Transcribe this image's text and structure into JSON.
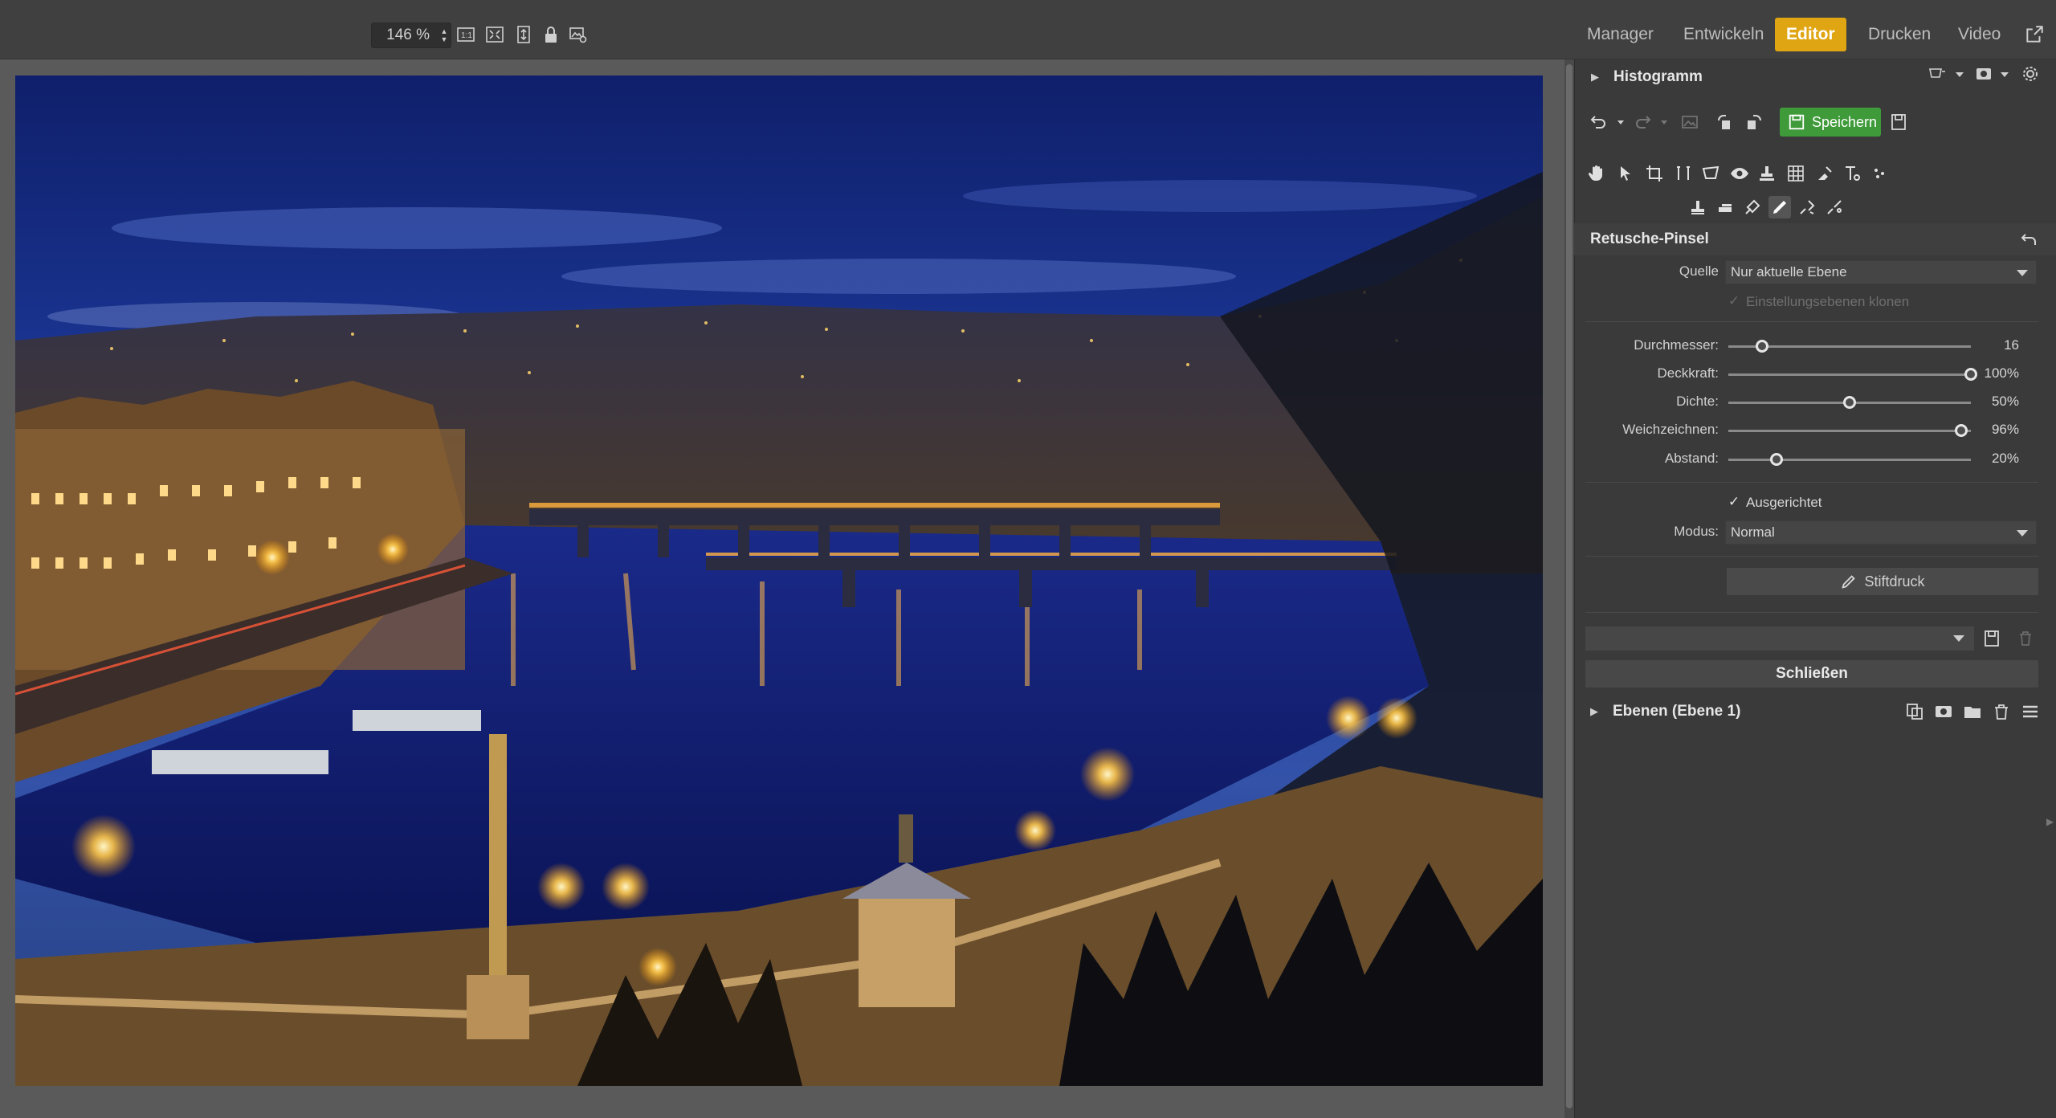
{
  "toolbar": {
    "zoom_value": "146 %"
  },
  "modules": {
    "tabs": [
      {
        "label": "Manager"
      },
      {
        "label": "Entwickeln"
      },
      {
        "label": "Editor",
        "active": true
      },
      {
        "label": "Drucken"
      },
      {
        "label": "Video"
      }
    ],
    "accent_color": "#e0a512"
  },
  "panel": {
    "histogram_title": "Histogramm",
    "save_label": "Speichern",
    "tool_title": "Retusche-Pinsel",
    "source": {
      "label": "Quelle",
      "value": "Nur aktuelle Ebene"
    },
    "clone_adjustments_label": "Einstellungsebenen klonen",
    "sliders": [
      {
        "label": "Durchmesser:",
        "value": "16",
        "position": 0.14
      },
      {
        "label": "Deckkraft:",
        "value": "100%",
        "position": 1.0
      },
      {
        "label": "Dichte:",
        "value": "50%",
        "position": 0.5
      },
      {
        "label": "Weichzeichnen:",
        "value": "96%",
        "position": 0.96
      },
      {
        "label": "Abstand:",
        "value": "20%",
        "position": 0.2
      }
    ],
    "aligned_label": "Ausgerichtet",
    "aligned_checked": true,
    "mode": {
      "label": "Modus:",
      "value": "Normal"
    },
    "pressure_label": "Stiftdruck",
    "close_label": "Schließen",
    "layers_title": "Ebenen (Ebene 1)"
  }
}
